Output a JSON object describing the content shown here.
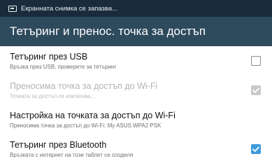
{
  "status_bar": {
    "notification_icon": "screenshot-icon",
    "text": "Екранната снимка се запазва..."
  },
  "action_bar": {
    "title": "Тетъринг и пренос. точка за достъп"
  },
  "settings": [
    {
      "title": "Тетъринг през USB",
      "summary": "Връзка през USB, проверете за тетъринг",
      "state": "unchecked",
      "enabled": true
    },
    {
      "title": "Преносима точка за достъп до Wi-Fi",
      "summary": "Точката за достъп се изключва...",
      "state": "checked",
      "enabled": false
    },
    {
      "title": "Настройка на точката за достъп до Wi-Fi",
      "summary": "Преносима точка за достъп до Wi-Fi: My ASUS WPA2 PSK",
      "state": "none",
      "enabled": true
    },
    {
      "title": "Тетъринг през Bluetooth",
      "summary": "Връзката с интернет на този таблет се споделя",
      "state": "checked",
      "enabled": true
    }
  ],
  "colors": {
    "status_bar_bg": "#1a2c3b",
    "action_bar_bg": "#2e4a5d",
    "checkbox_checked": "#3d9ad9",
    "checkbox_disabled": "#c9c9c9"
  }
}
